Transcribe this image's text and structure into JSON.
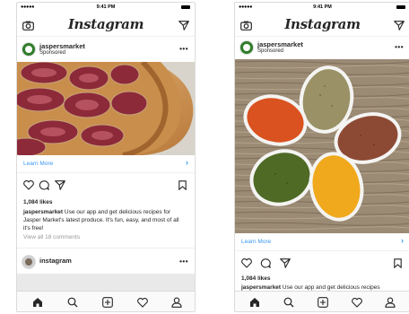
{
  "status_bar": {
    "signal": "●●●●●",
    "carrier": "",
    "time": "9:41 PM"
  },
  "app": {
    "brand": "Instagram"
  },
  "post1": {
    "username": "jaspersmarket",
    "sponsored": "Sponsored",
    "cta": "Learn More",
    "likes": "1,084 likes",
    "caption_user": "jaspersmarket",
    "caption_text": "Use our app and get delicious recipes for Jasper Market's latest produce. It's fun, easy, and most of all it's free!",
    "view_comments": "View all 18 comments"
  },
  "post1_next": {
    "username": "instagram"
  },
  "post2": {
    "username": "jaspersmarket",
    "sponsored": "Sponsored",
    "cta": "Learn More",
    "likes": "1,084 likes",
    "caption_user": "jaspersmarket",
    "caption_text": "Use our app and get delicious recipes"
  },
  "icons": {
    "camera": "camera-icon",
    "send": "direct-send-icon",
    "more": "more-options-icon",
    "heart": "heart-icon",
    "comment": "comment-icon",
    "share": "share-icon",
    "bookmark": "bookmark-icon",
    "home": "home-icon",
    "search": "search-icon",
    "add": "add-post-icon",
    "activity": "activity-heart-icon",
    "profile": "profile-icon"
  },
  "colors": {
    "link": "#3897f0",
    "border": "#dbdbdb",
    "text": "#262626",
    "muted": "#999999"
  }
}
